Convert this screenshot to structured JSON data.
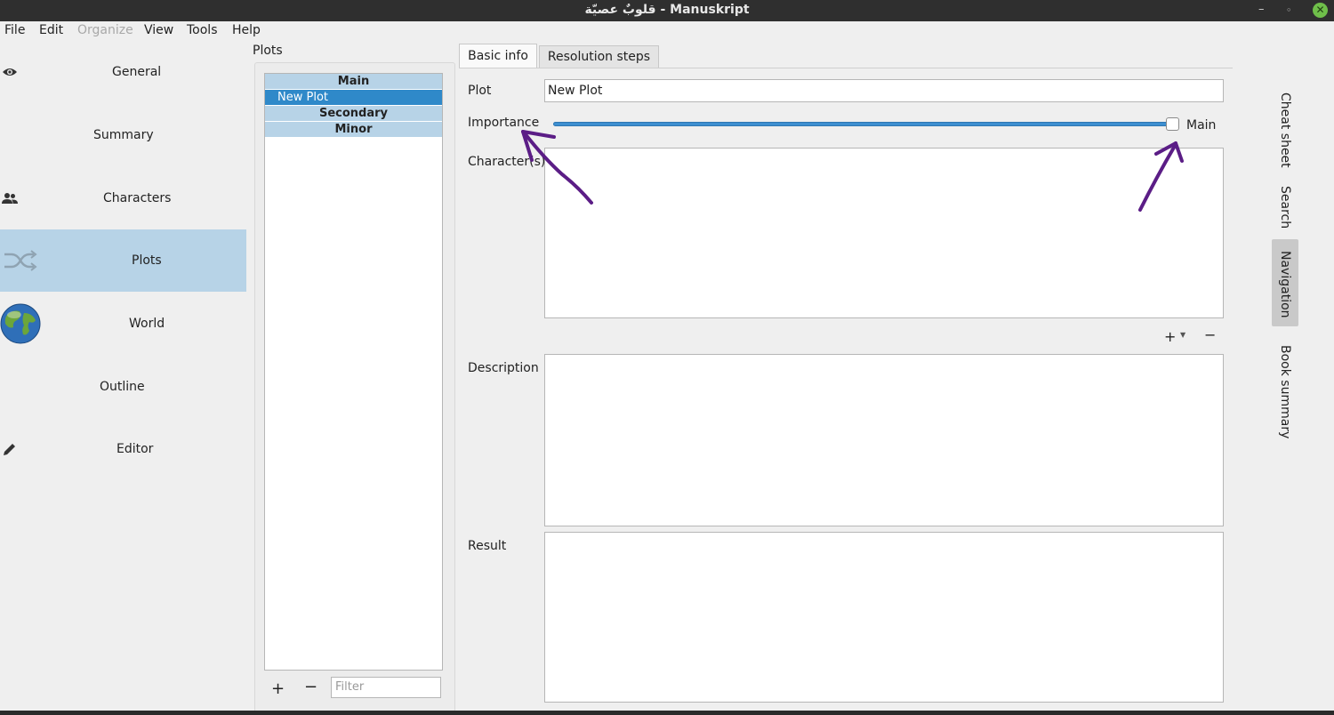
{
  "window": {
    "title": "قلوبٌ عصيّة - Manuskript"
  },
  "menu": [
    {
      "label": "File",
      "disabled": false
    },
    {
      "label": "Edit",
      "disabled": false
    },
    {
      "label": "Organize",
      "disabled": true
    },
    {
      "label": "View",
      "disabled": false
    },
    {
      "label": "Tools",
      "disabled": false
    },
    {
      "label": "Help",
      "disabled": false
    }
  ],
  "nav": [
    {
      "label": "General",
      "icon": "eye-icon"
    },
    {
      "label": "Summary",
      "icon": ""
    },
    {
      "label": "Characters",
      "icon": "people-icon"
    },
    {
      "label": "Plots",
      "icon": "shuffle-icon",
      "active": true
    },
    {
      "label": "World",
      "icon": "globe-icon"
    },
    {
      "label": "Outline",
      "icon": ""
    },
    {
      "label": "Editor",
      "icon": "pencil-icon"
    }
  ],
  "plots_panel": {
    "title": "Plots",
    "list": [
      {
        "text": "Main",
        "kind": "group"
      },
      {
        "text": "New Plot",
        "kind": "item",
        "selected": true
      },
      {
        "text": "Secondary",
        "kind": "group"
      },
      {
        "text": "Minor",
        "kind": "group"
      }
    ],
    "add_label": "+",
    "remove_label": "−",
    "filter_placeholder": "Filter"
  },
  "tabs": [
    {
      "label": "Basic info",
      "active": true
    },
    {
      "label": "Resolution steps",
      "active": false
    }
  ],
  "form": {
    "plot_label": "Plot",
    "plot_value": "New Plot",
    "importance_label": "Importance",
    "importance_value": "Main",
    "importance_level": 1.0,
    "characters_label": "Character(s)",
    "add_character": "+",
    "remove_character": "−",
    "description_label": "Description",
    "result_label": "Result"
  },
  "side_tabs": [
    {
      "label": "Cheat sheet",
      "active": false
    },
    {
      "label": "Search",
      "active": false
    },
    {
      "label": "Navigation",
      "active": true
    },
    {
      "label": "Book summary",
      "active": false
    }
  ],
  "colors": {
    "selection_bg": "#b7d3e7",
    "selected_item": "#2f89c9",
    "annotation_arrow": "#5b1d86"
  }
}
